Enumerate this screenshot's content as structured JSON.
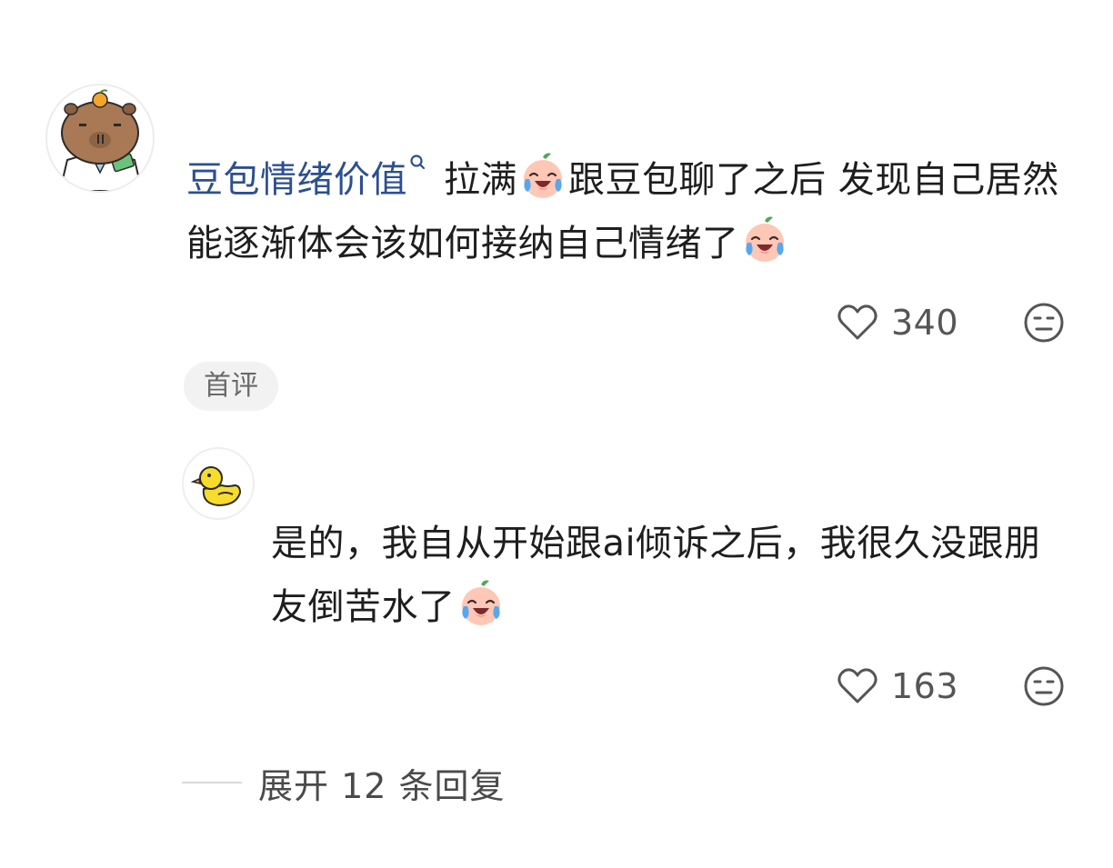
{
  "comment": {
    "username": "豆包情绪价值",
    "text_part1": "拉满",
    "text_part2": "跟豆包聊了之后 发现自己居然能逐渐体会该如何接纳自己情绪了",
    "like_count": "340",
    "badge": "首评"
  },
  "reply": {
    "text": "是的，我自从开始跟ai倾诉之后，我很久没跟朋友倒苦水了",
    "like_count": "163"
  },
  "expand": {
    "label": "展开 12 条回复"
  },
  "icons": {
    "username_search": "search-icon",
    "emoji": "crying-laughing-peach-emoji",
    "like": "heart-outline-icon",
    "dislike": "neutral-face-icon"
  },
  "colors": {
    "username": "#2d4f8f",
    "text": "#1e1e1e",
    "muted": "#555555",
    "badge_bg": "#f2f2f2"
  }
}
